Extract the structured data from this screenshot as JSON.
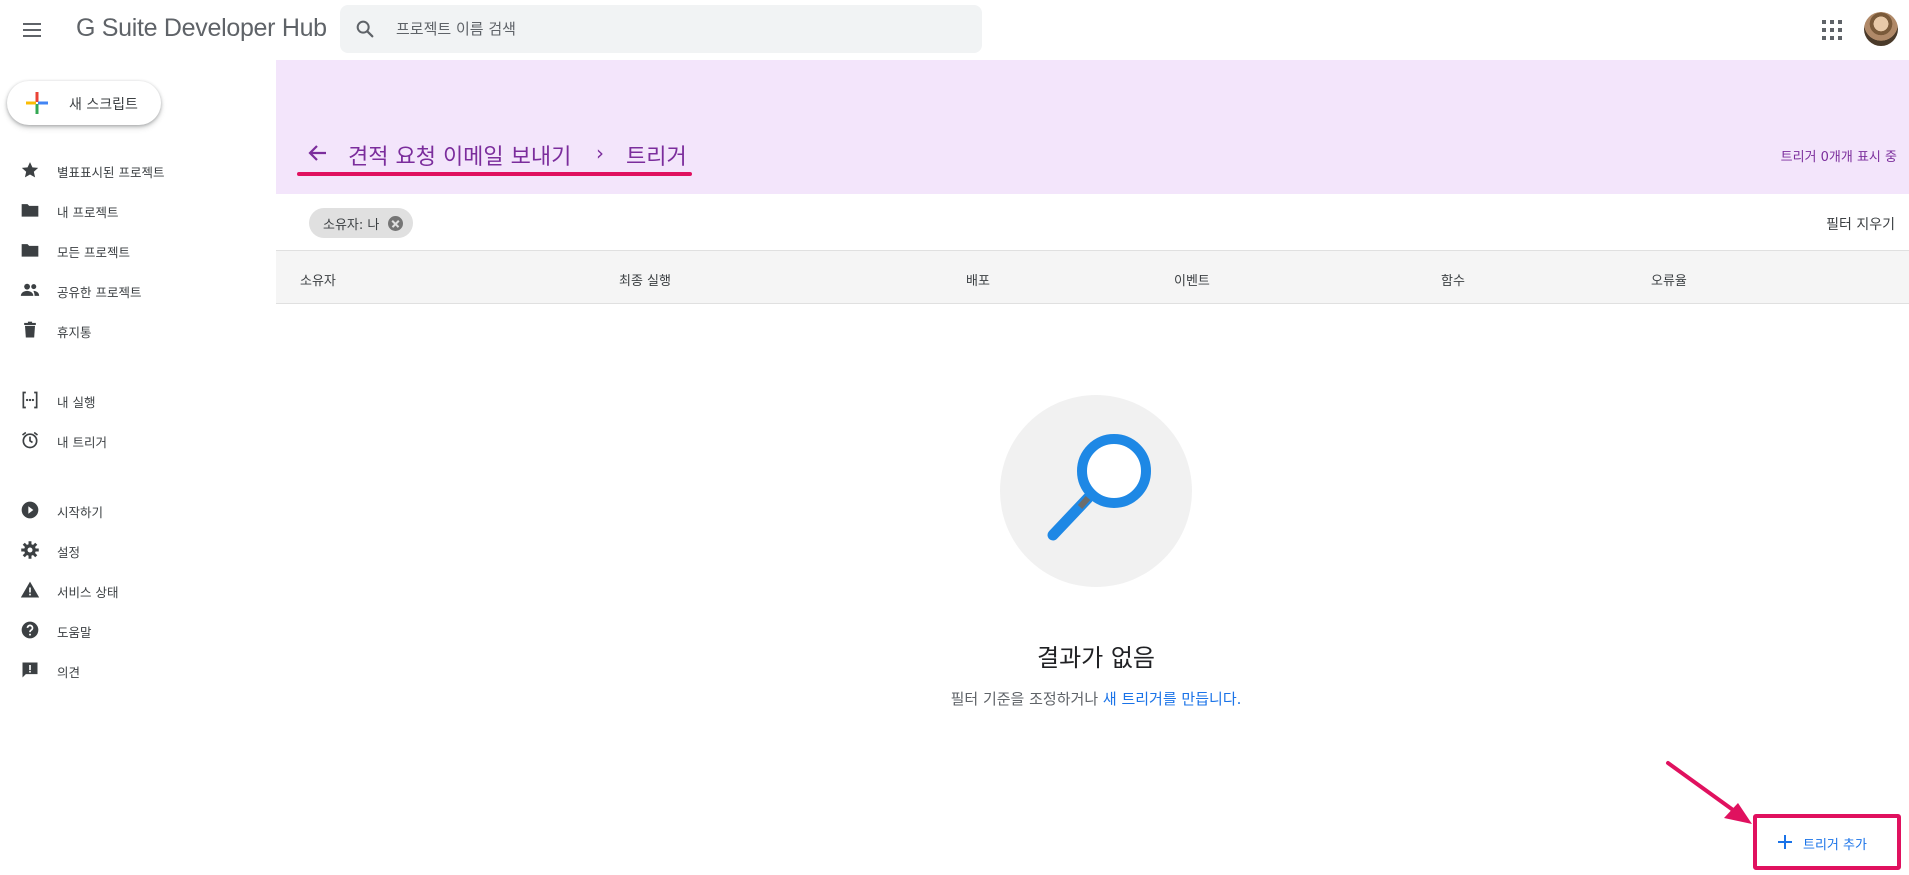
{
  "app": {
    "logo_text": "G Suite Developer Hub"
  },
  "search": {
    "placeholder": "프로젝트 이름 검색"
  },
  "sidebar": {
    "new_script_label": "새 스크립트",
    "items": [
      {
        "label": "별표표시된 프로젝트",
        "icon": "star-icon"
      },
      {
        "label": "내 프로젝트",
        "icon": "folder-icon"
      },
      {
        "label": "모든 프로젝트",
        "icon": "folder-icon"
      },
      {
        "label": "공유한 프로젝트",
        "icon": "people-icon"
      },
      {
        "label": "휴지통",
        "icon": "trash-icon"
      },
      {
        "label": "내 실행",
        "icon": "executions-icon"
      },
      {
        "label": "내 트리거",
        "icon": "alarm-icon"
      },
      {
        "label": "시작하기",
        "icon": "play-circle-icon"
      },
      {
        "label": "설정",
        "icon": "gear-icon"
      },
      {
        "label": "서비스 상태",
        "icon": "warning-icon"
      },
      {
        "label": "도움말",
        "icon": "help-icon"
      },
      {
        "label": "의견",
        "icon": "feedback-icon"
      }
    ]
  },
  "header": {
    "project_name": "견적 요청 이메일 보내기",
    "separator": "›",
    "current_page": "트리거",
    "count_text": "트리거 0개개 표시 중",
    "accent_color": "#7b2d9c",
    "band_color": "#f3e5fb",
    "highlight_color": "#e0115f"
  },
  "filters": {
    "chip_label": "소유자: 나",
    "clear_label": "필터 지우기"
  },
  "table": {
    "columns": [
      "소유자",
      "최종 실행",
      "배포",
      "이벤트",
      "함수",
      "오류율"
    ]
  },
  "empty_state": {
    "title": "결과가 없음",
    "subtitle_prefix": "필터 기준을 조정하거나 ",
    "subtitle_link": "새 트리거를 만듭니다."
  },
  "add_trigger": {
    "label": "트리거 추가"
  }
}
